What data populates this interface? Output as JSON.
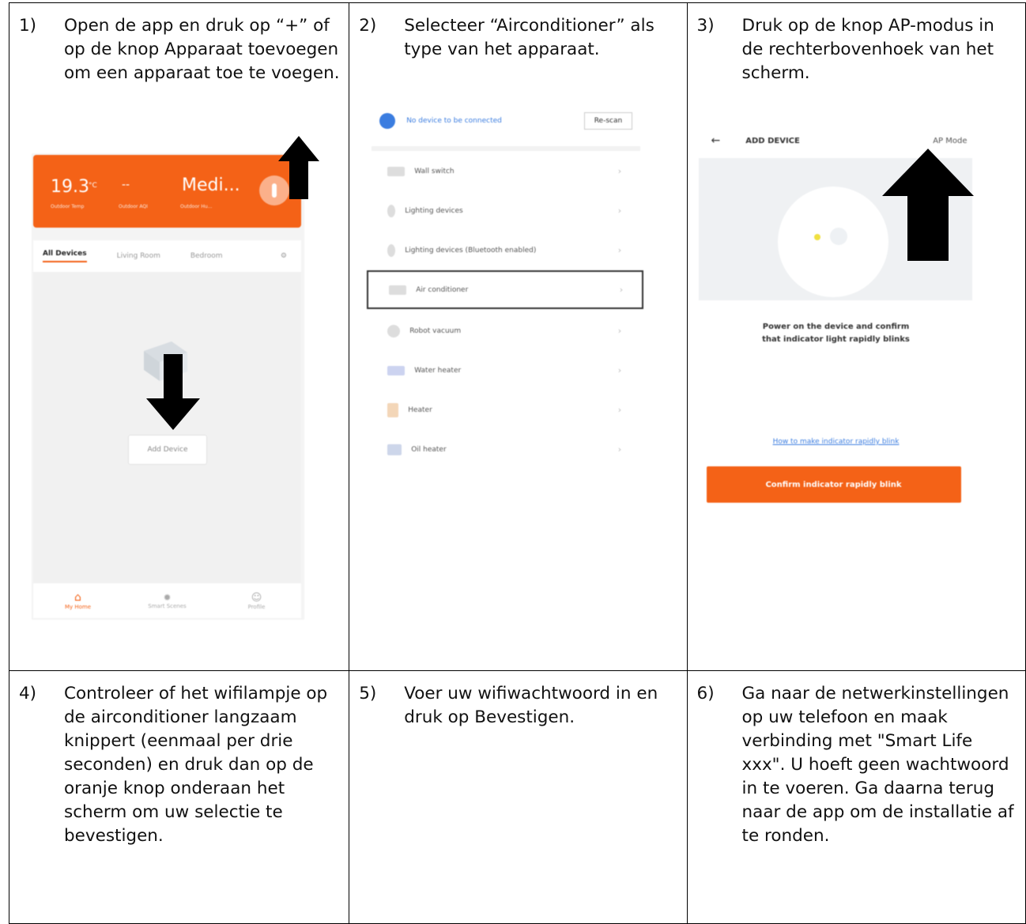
{
  "steps": [
    {
      "num": "1)",
      "text": "Open de app en druk op “+” of op de knop Apparaat toevoegen om een apparaat toe te voegen."
    },
    {
      "num": "2)",
      "text": "Selecteer “Airconditioner” als type van het apparaat."
    },
    {
      "num": "3)",
      "text": "Druk op de knop AP-modus in de rechterbovenhoek van het scherm."
    },
    {
      "num": "4)",
      "text": "Controleer of het wifilampje op de airconditioner langzaam knippert (eenmaal per drie seconden) en druk dan op de oranje knop onderaan het scherm om uw selectie te bevestigen."
    },
    {
      "num": "5)",
      "text": "Voer uw wifiwachtwoord in en druk op Bevestigen."
    },
    {
      "num": "6)",
      "text": "Ga naar de netwerkinstellingen op uw telefoon en maak verbinding met \"Smart Life xxx\". U hoeft geen wachtwoord in te voeren. Ga daarna terug naar de app om de installatie af te ronden."
    }
  ],
  "screen1": {
    "temp": "19.3",
    "temp_unit": "°C",
    "dash": "--",
    "mode": "Medi...",
    "sub_labels": [
      "Outdoor Temp",
      "Outdoor AQI",
      "Outdoor Hu..."
    ],
    "tabs": [
      "All Devices",
      "Living Room",
      "Bedroom"
    ],
    "add_device": "Add Device",
    "nav": [
      "My Home",
      "Smart Scenes",
      "Profile"
    ]
  },
  "screen2": {
    "status": "No device to be connected",
    "rescan": "Re-scan",
    "devices": [
      "Wall switch",
      "Lighting devices",
      "Lighting devices (Bluetooth enabled)",
      "Air conditioner",
      "Robot vacuum",
      "Water heater",
      "Heater",
      "Oil heater"
    ]
  },
  "screen3": {
    "title": "ADD DEVICE",
    "ap_mode": "AP Mode",
    "instruction_1": "Power on the device and confirm",
    "instruction_2": "that indicator light rapidly blinks",
    "link": "How to make indicator rapidly blink",
    "confirm": "Confirm indicator rapidly blink"
  },
  "colors": {
    "accent": "#f46217",
    "link": "#3b7de0"
  }
}
